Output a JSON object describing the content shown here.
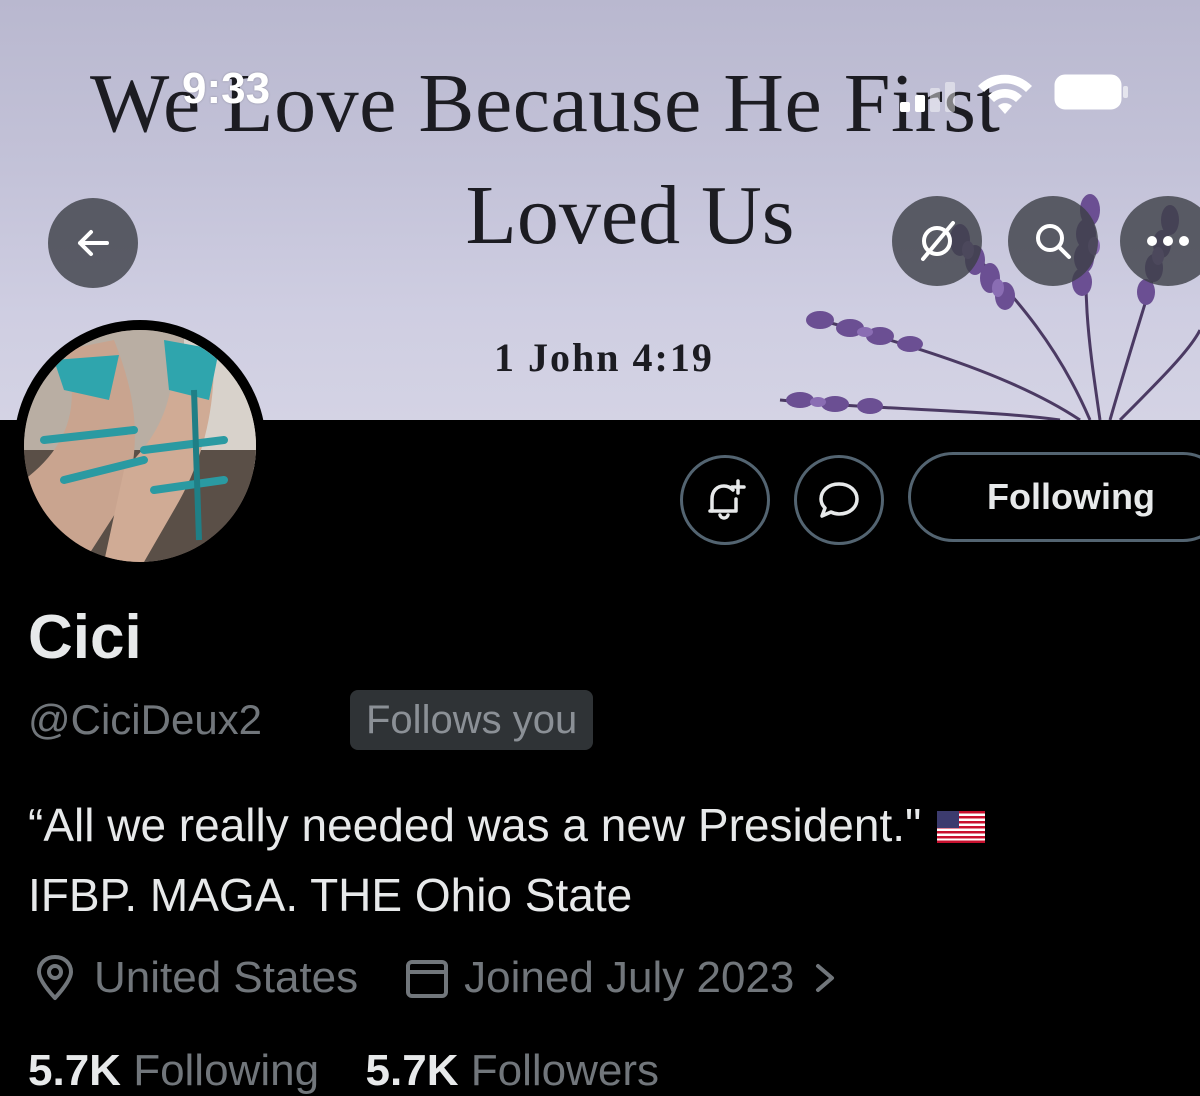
{
  "banner": {
    "line1": "We Love Because He First",
    "line2": "Loved Us",
    "verse": "1 John 4:19"
  },
  "status_bar": {
    "time": "9:33"
  },
  "profile": {
    "display_name": "Cici",
    "handle": "@CiciDeux2",
    "follows_you": "Follows you",
    "bio_line1": "“All we really needed was a new President.\"",
    "bio_line2": "IFBP. MAGA. THE Ohio State",
    "location": "United States",
    "joined": "Joined July 2023",
    "following_count": "5.7K",
    "following_label": "Following",
    "followers_count": "5.7K",
    "followers_label": "Followers"
  },
  "actions": {
    "following_button": "Following"
  },
  "icons": {
    "back": "arrow-left-icon",
    "grok": "grok-icon",
    "search": "search-icon",
    "more": "more-icon",
    "notify": "bell-plus-icon",
    "message": "message-icon",
    "location": "location-pin-icon",
    "calendar": "calendar-icon",
    "chevron": "chevron-right-icon",
    "flag": "us-flag-icon"
  },
  "colors": {
    "background": "#000000",
    "text_primary": "#e7e9ea",
    "text_secondary": "#71767b",
    "border": "#536471",
    "badge_bg": "#2f3336"
  }
}
